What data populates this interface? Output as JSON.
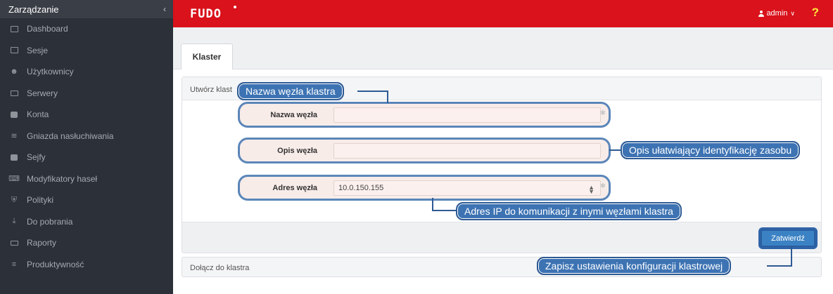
{
  "sidebar": {
    "title": "Zarządzanie",
    "collapse_icon": "chevron-left-icon",
    "collapse_glyph": "‹",
    "items": [
      {
        "label": "Dashboard",
        "icon": "chart-icon"
      },
      {
        "label": "Sesje",
        "icon": "film-icon"
      },
      {
        "label": "Użytkownicy",
        "icon": "users-icon"
      },
      {
        "label": "Serwery",
        "icon": "server-icon"
      },
      {
        "label": "Konta",
        "icon": "book-icon"
      },
      {
        "label": "Gniazda nasłuchiwania",
        "icon": "rss-icon"
      },
      {
        "label": "Sejfy",
        "icon": "safe-icon"
      },
      {
        "label": "Modyfikatory haseł",
        "icon": "sitemap-icon"
      },
      {
        "label": "Polityki",
        "icon": "shield-icon"
      },
      {
        "label": "Do pobrania",
        "icon": "download-icon"
      },
      {
        "label": "Raporty",
        "icon": "print-icon"
      },
      {
        "label": "Produktywność",
        "icon": "list-icon"
      }
    ]
  },
  "topbar": {
    "logo": "FUDO",
    "user": "admin",
    "user_caret": "∨",
    "help": "?"
  },
  "tabs": [
    {
      "label": "Klaster"
    }
  ],
  "panel": {
    "title": "Utwórz klast",
    "join_label": "Dołącz do klastra",
    "submit_label": "Zatwierdź"
  },
  "form": {
    "node_name": {
      "label": "Nazwa węzła",
      "value": ""
    },
    "node_description": {
      "label": "Opis węzła",
      "value": ""
    },
    "node_address": {
      "label": "Adres węzła",
      "value": "10.0.150.155"
    }
  },
  "callouts": {
    "node_name": "Nazwa węzła klastra",
    "description": "Opis ułatwiający identyfikację zasobu",
    "address": "Adres IP do komunikacji z inymi węzłami klastra",
    "submit": "Zapisz ustawienia konfiguracji klastrowej"
  },
  "colors": {
    "topbar": "#d9121b",
    "sidebar": "#2c3038",
    "callout": "#3d73b3",
    "help": "#ffeb3b"
  }
}
